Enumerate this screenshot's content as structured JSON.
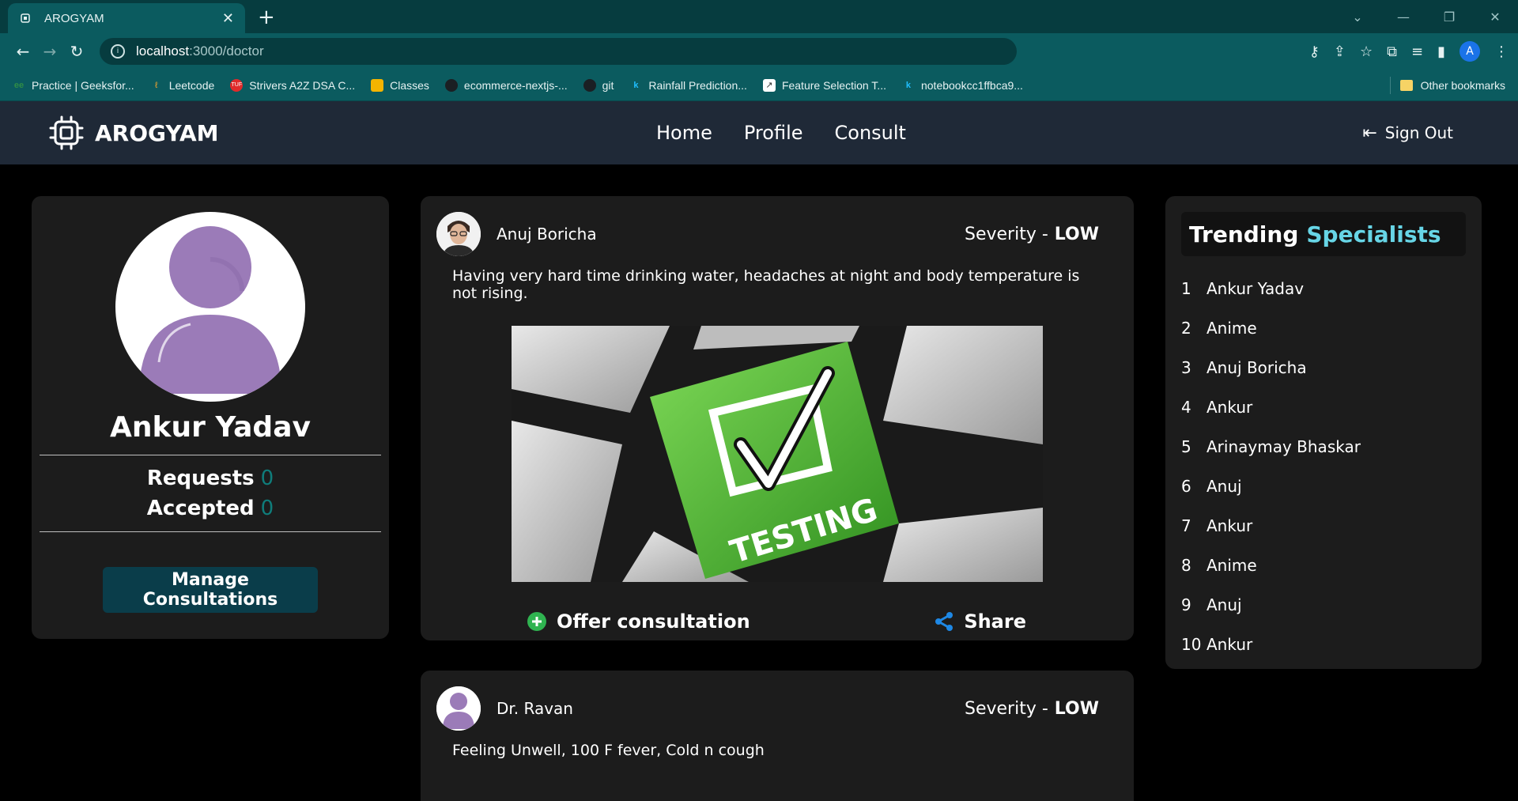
{
  "browser": {
    "tab_title": "AROGYAM",
    "url_host": "localhost",
    "url_path": ":3000/doctor",
    "bookmarks": [
      {
        "label": "Practice | Geeksfor...",
        "icon": "geeksforgeeks-icon"
      },
      {
        "label": "Leetcode",
        "icon": "leetcode-icon"
      },
      {
        "label": "Strivers A2Z DSA C...",
        "icon": "tuf-icon"
      },
      {
        "label": "Classes",
        "icon": "classroom-icon"
      },
      {
        "label": "ecommerce-nextjs-...",
        "icon": "github-icon"
      },
      {
        "label": "git",
        "icon": "github-icon"
      },
      {
        "label": "Rainfall Prediction...",
        "icon": "kaggle-icon"
      },
      {
        "label": "Feature Selection T...",
        "icon": "chart-icon"
      },
      {
        "label": "notebookcc1ffbca9...",
        "icon": "kaggle-icon"
      }
    ],
    "other_bookmarks": "Other bookmarks",
    "profile_initial": "A"
  },
  "nav": {
    "brand": "AROGYAM",
    "links": [
      "Home",
      "Profile",
      "Consult"
    ],
    "sign_out": "Sign Out"
  },
  "profile": {
    "name": "Ankur Yadav",
    "requests_label": "Requests",
    "requests_value": "0",
    "accepted_label": "Accepted",
    "accepted_value": "0",
    "manage_button": "Manage Consultations"
  },
  "posts": [
    {
      "author": "Anuj Boricha",
      "severity_label": "Severity -",
      "severity_value": "LOW",
      "text": "Having very hard time drinking water, headaches at night and body temperature is not rising.",
      "image_caption": "TESTING",
      "offer_label": "Offer consultation",
      "share_label": "Share"
    },
    {
      "author": "Dr. Ravan",
      "severity_label": "Severity -",
      "severity_value": "LOW",
      "text": "Feeling Unwell, 100 F fever, Cold n cough"
    }
  ],
  "trending": {
    "title_prefix": "Trending",
    "title_accent": "Specialists",
    "items": [
      {
        "rank": "1",
        "name": "Ankur Yadav"
      },
      {
        "rank": "2",
        "name": "Anime"
      },
      {
        "rank": "3",
        "name": "Anuj Boricha"
      },
      {
        "rank": "4",
        "name": "Ankur"
      },
      {
        "rank": "5",
        "name": "Arinaymay Bhaskar"
      },
      {
        "rank": "6",
        "name": "Anuj"
      },
      {
        "rank": "7",
        "name": "Ankur"
      },
      {
        "rank": "8",
        "name": "Anime"
      },
      {
        "rank": "9",
        "name": "Anuj"
      },
      {
        "rank": "10",
        "name": "Ankur"
      }
    ]
  },
  "colors": {
    "accent": "#67d5e6",
    "teal_count": "#0f7c7a",
    "button_bg": "#0a3d4a",
    "navbar_bg": "#1f2937",
    "card_bg": "#1c1c1c"
  }
}
